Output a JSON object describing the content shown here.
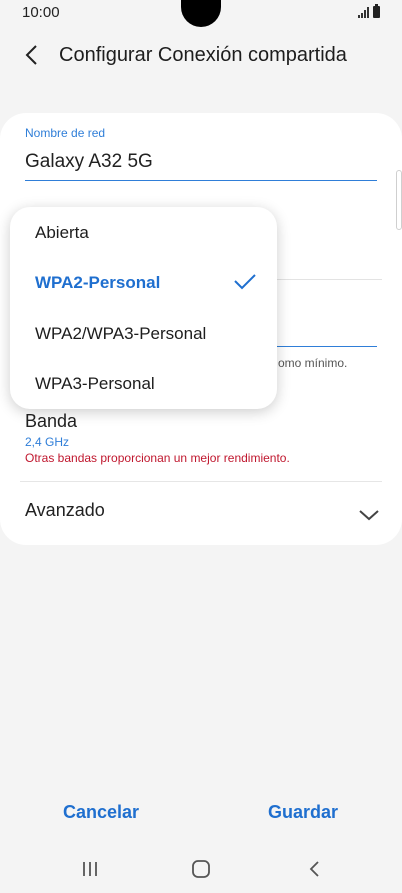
{
  "status_bar": {
    "time": "10:00"
  },
  "header": {
    "title": "Configurar Conexión compartida"
  },
  "network": {
    "label": "Nombre de red",
    "value": "Galaxy A32 5G"
  },
  "password": {
    "hint_partial": "omo mínimo."
  },
  "band": {
    "label": "Banda",
    "value": "2,4 GHz",
    "note": "Otras bandas proporcionan un mejor rendimiento."
  },
  "advanced": {
    "label": "Avanzado"
  },
  "security_dropdown": {
    "options": [
      "Abierta",
      "WPA2-Personal",
      "WPA2/WPA3-Personal",
      "WPA3-Personal"
    ],
    "selected": "WPA2-Personal"
  },
  "actions": {
    "cancel": "Cancelar",
    "save": "Guardar"
  },
  "colors": {
    "accent": "#1f6fcf",
    "warning": "#c0172e",
    "background": "#f4f4f4"
  }
}
